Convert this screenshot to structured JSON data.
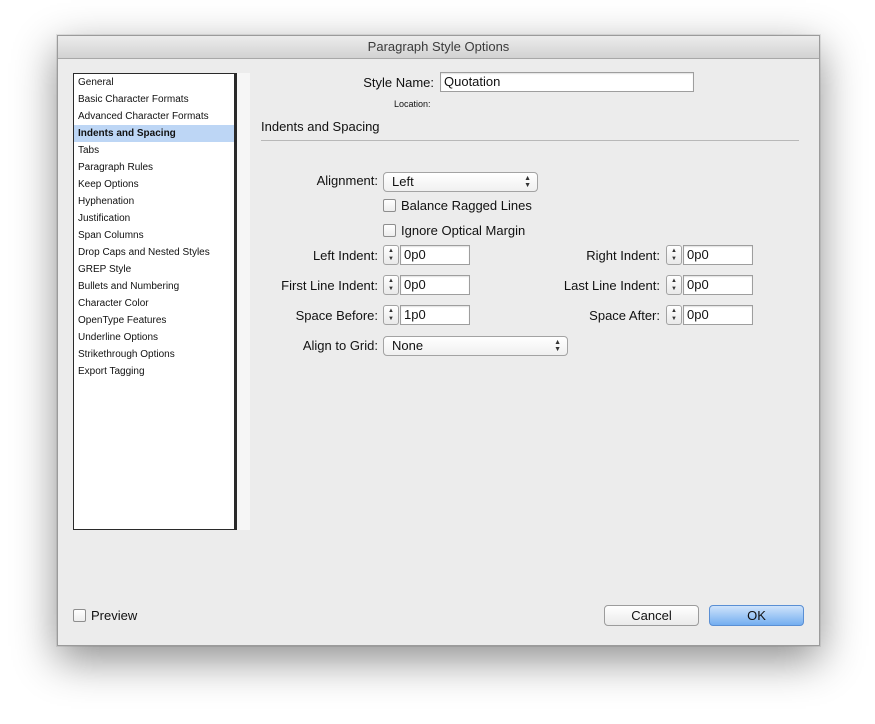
{
  "window": {
    "title": "Paragraph Style Options"
  },
  "sidebar": {
    "items": [
      {
        "label": "General"
      },
      {
        "label": "Basic Character Formats"
      },
      {
        "label": "Advanced Character Formats"
      },
      {
        "label": "Indents and Spacing",
        "selected": true
      },
      {
        "label": "Tabs"
      },
      {
        "label": "Paragraph Rules"
      },
      {
        "label": "Keep Options"
      },
      {
        "label": "Hyphenation"
      },
      {
        "label": "Justification"
      },
      {
        "label": "Span Columns"
      },
      {
        "label": "Drop Caps and Nested Styles"
      },
      {
        "label": "GREP Style"
      },
      {
        "label": "Bullets and Numbering"
      },
      {
        "label": "Character Color"
      },
      {
        "label": "OpenType Features"
      },
      {
        "label": "Underline Options"
      },
      {
        "label": "Strikethrough Options"
      },
      {
        "label": "Export Tagging"
      }
    ]
  },
  "style_name": {
    "label": "Style Name:",
    "value": "Quotation"
  },
  "location": {
    "label": "Location:"
  },
  "section": {
    "title": "Indents and Spacing"
  },
  "alignment": {
    "label": "Alignment:",
    "value": "Left"
  },
  "balance_ragged_lines": {
    "label": "Balance Ragged Lines",
    "checked": false
  },
  "ignore_optical_margin": {
    "label": "Ignore Optical Margin",
    "checked": false
  },
  "left_indent": {
    "label": "Left Indent:",
    "value": "0p0"
  },
  "right_indent": {
    "label": "Right Indent:",
    "value": "0p0"
  },
  "first_line_indent": {
    "label": "First Line Indent:",
    "value": "0p0"
  },
  "last_line_indent": {
    "label": "Last Line Indent:",
    "value": "0p0"
  },
  "space_before": {
    "label": "Space Before:",
    "value": "1p0"
  },
  "space_after": {
    "label": "Space After:",
    "value": "0p0"
  },
  "align_to_grid": {
    "label": "Align to Grid:",
    "value": "None"
  },
  "preview": {
    "label": "Preview",
    "checked": false
  },
  "buttons": {
    "cancel": "Cancel",
    "ok": "OK"
  },
  "icons": {
    "popup_arrows": "▲▼",
    "stepper_arrows": "▲▼"
  },
  "colors": {
    "selection": "#bdd6f5",
    "default_button": "#74aef0"
  }
}
